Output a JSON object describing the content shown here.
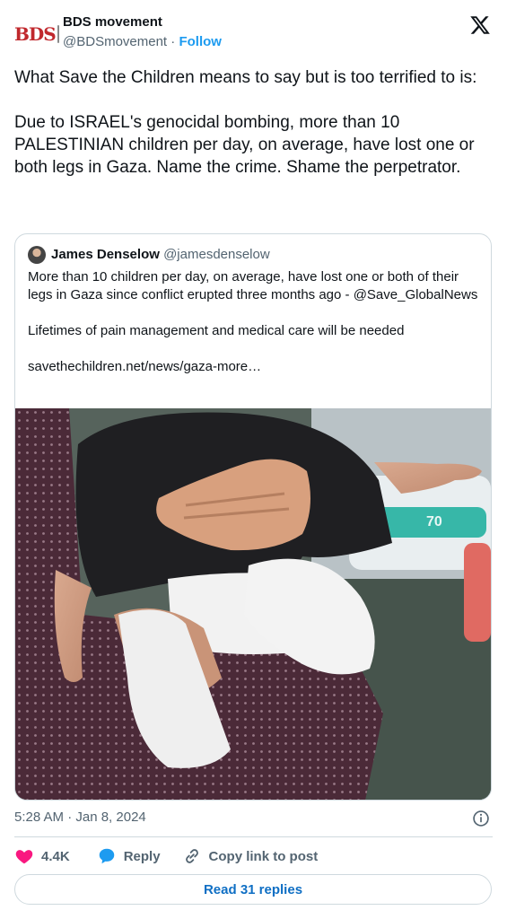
{
  "author": {
    "logo_text": "BDS",
    "name": "BDS movement",
    "handle": "@BDSmovement",
    "separator": "·",
    "follow_label": "Follow"
  },
  "tweet": {
    "text": "What Save the Children means to say but is too terrified to is:\n\nDue to ISRAEL's genocidal bombing, more than 10 PALESTINIAN children per day, on average, have lost one or both legs in Gaza. Name the crime. Shame the perpetrator."
  },
  "quoted": {
    "name": "James Denselow",
    "handle": "@jamesdenselow",
    "text": "More than 10 children per day, on average, have lost one or both of their legs in Gaza since conflict erupted three months ago - @Save_GlobalNews\n\nLifetimes of pain management and medical care will be needed\n\nsavethechildren.net/news/gaza-more…",
    "media": {
      "pack_label": "70"
    }
  },
  "timestamp": "5:28 AM · Jan 8, 2024",
  "actions": {
    "likes": "4.4K",
    "reply_label": "Reply",
    "copy_label": "Copy link to post"
  },
  "read_replies_label": "Read 31 replies",
  "colors": {
    "accent": "#1d9bf0",
    "heart": "#f91880",
    "brand_red": "#c0282d"
  },
  "icons": [
    "x-logo-icon",
    "heart-icon",
    "reply-icon",
    "link-icon",
    "info-icon"
  ]
}
